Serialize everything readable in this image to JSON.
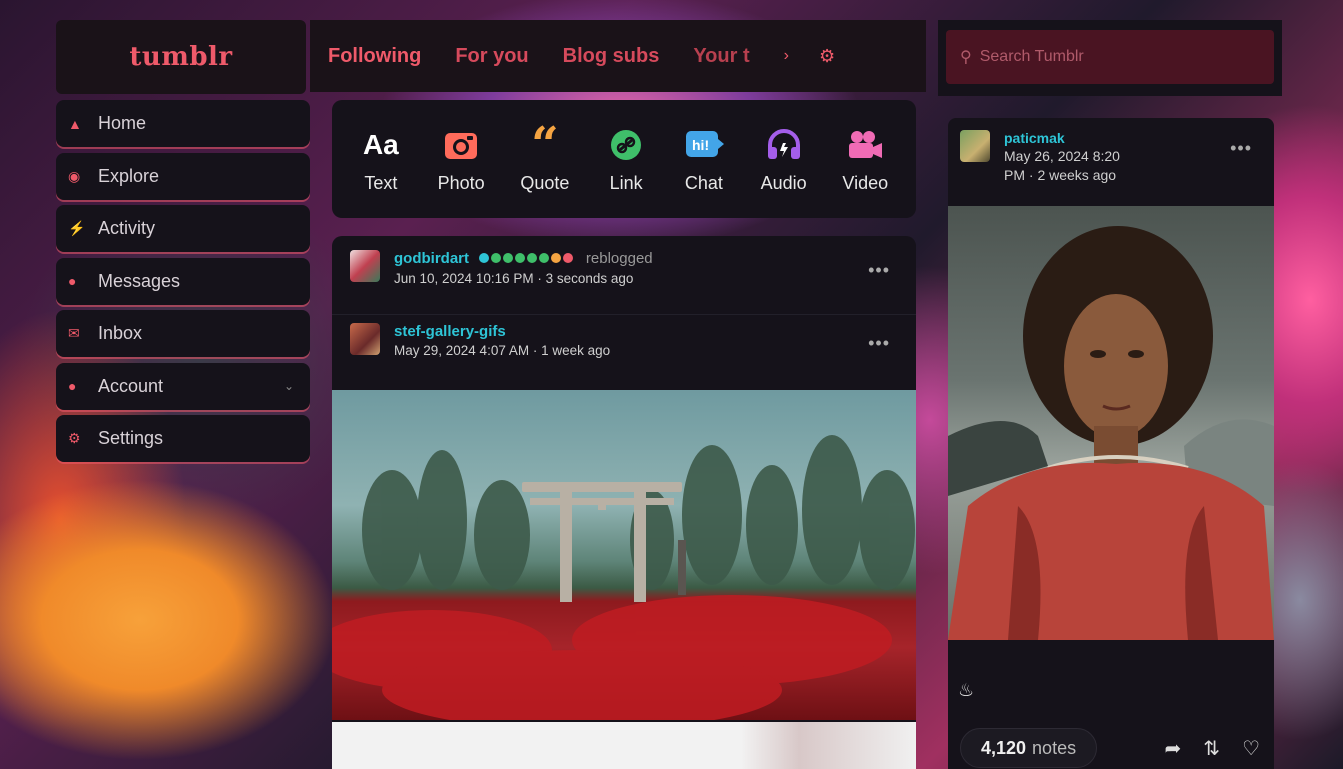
{
  "app": {
    "logo": "tumblr"
  },
  "nav": {
    "items": [
      {
        "label": "Home",
        "icon": "home-icon"
      },
      {
        "label": "Explore",
        "icon": "compass-icon"
      },
      {
        "label": "Activity",
        "icon": "lightning-icon"
      },
      {
        "label": "Messages",
        "icon": "chat-bubble-icon"
      },
      {
        "label": "Inbox",
        "icon": "envelope-icon"
      },
      {
        "label": "Account",
        "icon": "person-icon"
      },
      {
        "label": "Settings",
        "icon": "gear-icon"
      }
    ]
  },
  "tabs": [
    "Following",
    "For you",
    "Blog subs",
    "Your t"
  ],
  "search": {
    "placeholder": "Search Tumblr"
  },
  "post_types": [
    {
      "label": "Text",
      "icon": "Aa",
      "color": "#ffffff"
    },
    {
      "label": "Photo",
      "icon": "camera-icon",
      "color": "#ff6b5b"
    },
    {
      "label": "Quote",
      "icon": "66",
      "color": "#f5a442"
    },
    {
      "label": "Link",
      "icon": "link-icon",
      "color": "#3fbf6a"
    },
    {
      "label": "Chat",
      "icon": "hi!",
      "color": "#43a5e8"
    },
    {
      "label": "Audio",
      "icon": "headphones-icon",
      "color": "#a45eea"
    },
    {
      "label": "Video",
      "icon": "video-camera-icon",
      "color": "#f06bb5"
    }
  ],
  "feed": {
    "reblog": {
      "user": "godbirdart",
      "action": "reblogged",
      "timestamp": "Jun 10, 2024 10:16 PM · 3 seconds ago",
      "badge_colors": [
        "#2ec4d6",
        "#3fbf6a",
        "#3fbf6a",
        "#3fbf6a",
        "#3fbf6a",
        "#3fbf6a",
        "#f5a442",
        "#ef5a6a"
      ]
    },
    "post": {
      "user": "stef-gallery-gifs",
      "timestamp": "May 29, 2024 4:07 AM · 1 week ago"
    }
  },
  "side_post": {
    "user": "paticmak",
    "timestamp_line1": "May 26, 2024 8:20",
    "timestamp_line2": "PM · 2 weeks ago",
    "notes_count": "4,120",
    "notes_label": "notes"
  }
}
